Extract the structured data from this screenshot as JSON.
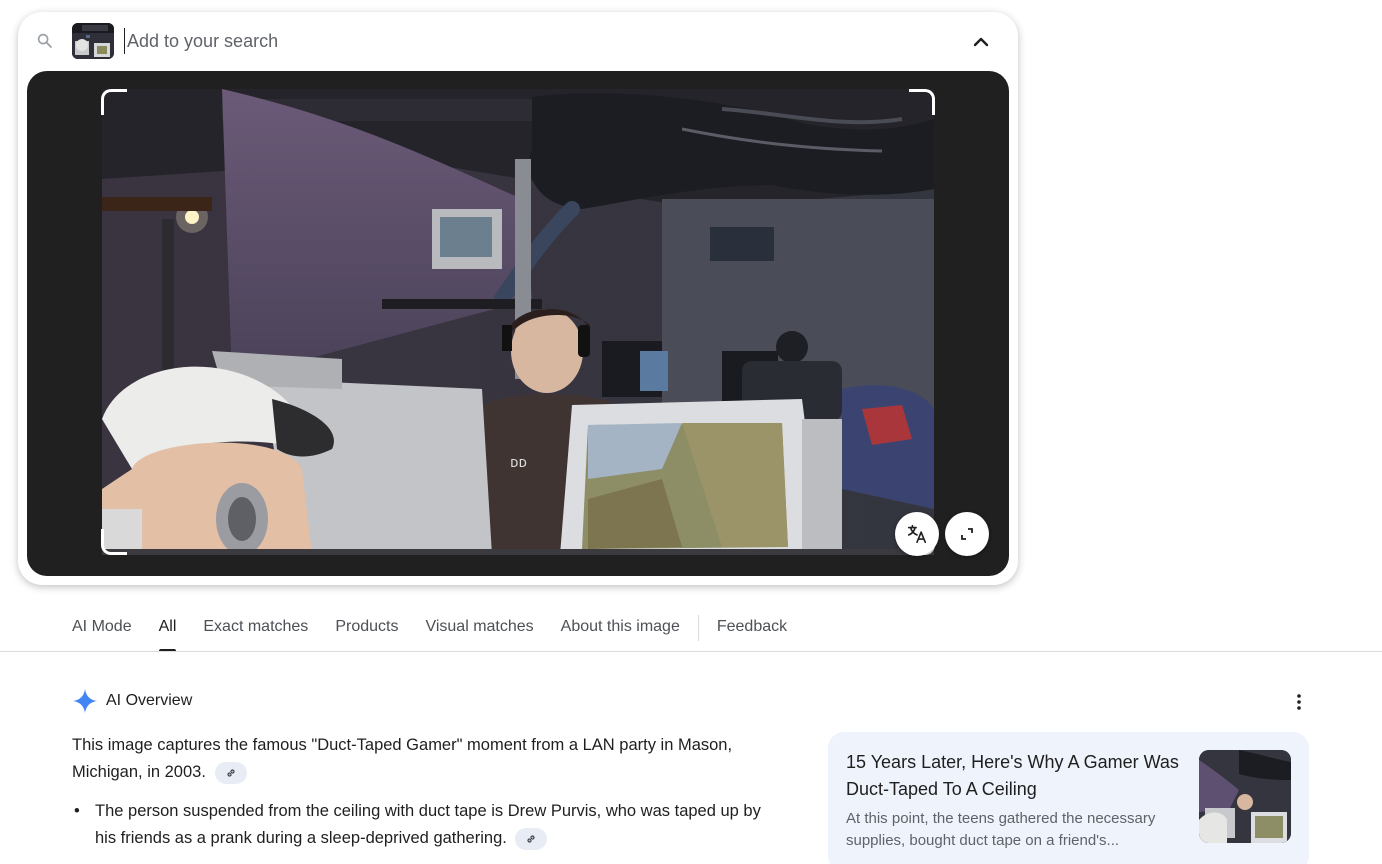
{
  "search": {
    "placeholder": "Add to your search",
    "value": ""
  },
  "tabs": [
    {
      "label": "AI Mode",
      "active": false
    },
    {
      "label": "All",
      "active": true
    },
    {
      "label": "Exact matches",
      "active": false
    },
    {
      "label": "Products",
      "active": false
    },
    {
      "label": "Visual matches",
      "active": false
    },
    {
      "label": "About this image",
      "active": false
    },
    {
      "label": "Feedback",
      "active": false
    }
  ],
  "ai_overview": {
    "title": "AI Overview",
    "summary": "This image captures the famous \"Duct-Taped Gamer\" moment from a LAN party in Mason, Michigan, in 2003.",
    "bullets": [
      "The person suspended from the ceiling with duct tape is Drew Purvis, who was taped up by his friends as a prank during a sleep-deprived gathering."
    ]
  },
  "source_card": {
    "title": "15 Years Later, Here's Why A Gamer Was Duct-Taped To A Ceiling",
    "snippet": "At this point, the teens gathered the necessary supplies, bought duct tape on a friend's..."
  },
  "icons": {
    "search": "search-icon",
    "collapse": "chevron-up-icon",
    "translate": "translate-icon",
    "expand": "expand-icon",
    "ai": "sparkle-icon",
    "link": "link-icon",
    "more": "more-vert-icon"
  },
  "colors": {
    "accent_blue": "#4285f4",
    "image_panel": "#202020",
    "source_card_bg": "#eef3fc"
  }
}
